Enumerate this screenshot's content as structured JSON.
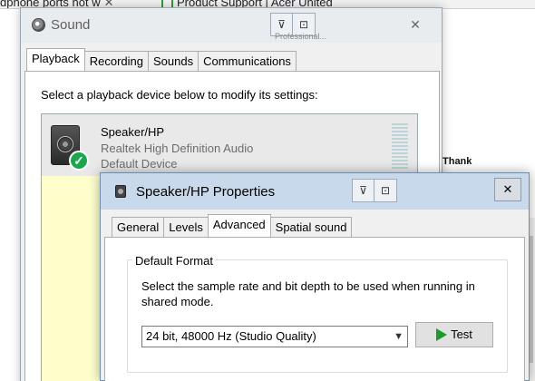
{
  "browser": {
    "tab1": "dphone ports not w",
    "tab2": "Product Support | Acer United"
  },
  "background": {
    "right_text": "Thank",
    "ghost_text": "Professional..."
  },
  "sound": {
    "title": "Sound",
    "close": "✕",
    "tools": [
      "⊽",
      "⊡"
    ],
    "tabs": [
      "Playback",
      "Recording",
      "Sounds",
      "Communications"
    ],
    "active_tab": "Playback",
    "instruction": "Select a playback device below to modify its settings:",
    "device": {
      "name": "Speaker/HP",
      "driver": "Realtek High Definition Audio",
      "status": "Default Device"
    }
  },
  "properties": {
    "title": "Speaker/HP Properties",
    "close": "✕",
    "tools": [
      "⊽",
      "⊡"
    ],
    "tabs": [
      "General",
      "Levels",
      "Advanced",
      "Spatial sound"
    ],
    "active_tab": "Advanced",
    "group_label": "Default Format",
    "description": "Select the sample rate and bit depth to be used when running in shared mode.",
    "format_value": "24 bit, 48000 Hz (Studio Quality)",
    "test_label": "Test"
  }
}
